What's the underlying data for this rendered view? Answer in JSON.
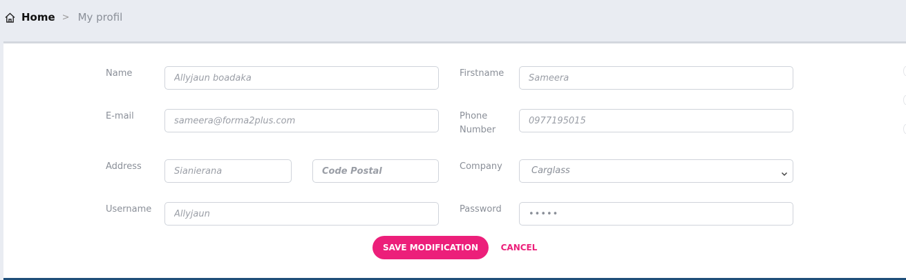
{
  "breadcrumb": {
    "home_label": "Home",
    "separator": ">",
    "current": "My profil"
  },
  "form": {
    "name": {
      "label": "Name",
      "placeholder": "Allyjaun boadaka"
    },
    "firstname": {
      "label": "Firstname",
      "placeholder": "Sameera"
    },
    "email": {
      "label": "E-mail",
      "placeholder": "sameera@forma2plus.com"
    },
    "phone": {
      "label_line1": "Phone",
      "label_line2": "Number",
      "placeholder": "0977195015"
    },
    "address": {
      "label": "Address",
      "placeholder": "Sianierana"
    },
    "postal": {
      "placeholder": "Code Postal"
    },
    "company": {
      "label": "Company",
      "value": "Carglass"
    },
    "username": {
      "label": "Username",
      "placeholder": "Allyjaun"
    },
    "password": {
      "label": "Password",
      "value": "•••••"
    }
  },
  "actions": {
    "save_label": "SAVE MODIFICATION",
    "cancel_label": "CANCEL"
  },
  "colors": {
    "accent": "#ec1f7a",
    "header_bg": "#e9ecf2",
    "bottom_border": "#1f4e79"
  },
  "icons": {
    "home": "home-icon",
    "chevron": "chevron-down-icon"
  }
}
